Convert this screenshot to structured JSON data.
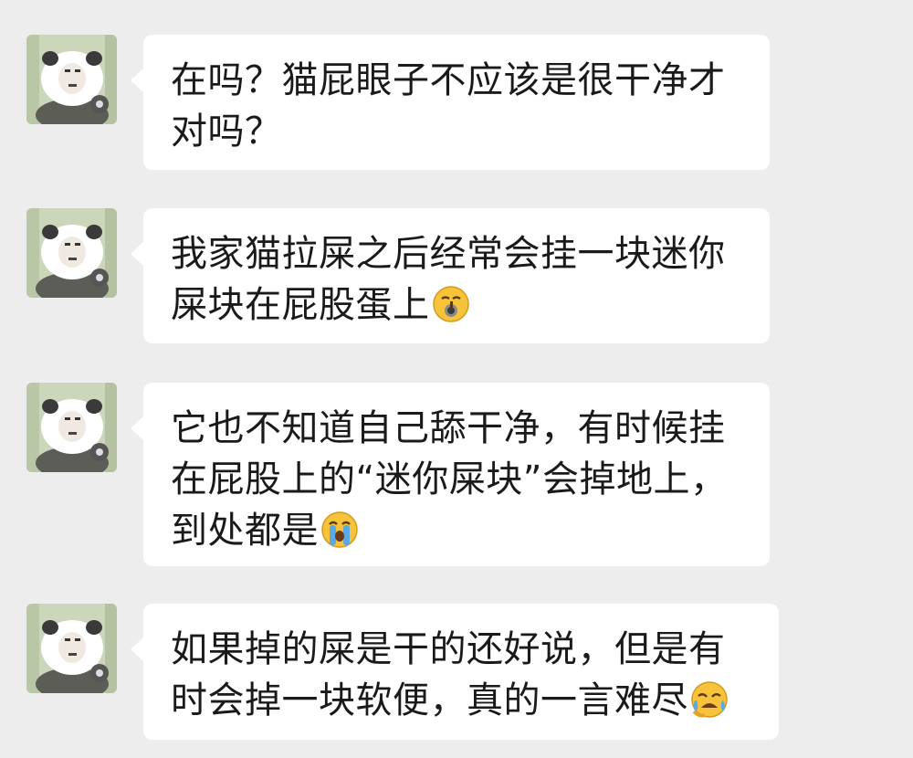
{
  "chat": {
    "messages": [
      {
        "text": "在吗？猫屁眼子不应该是很干净才对吗？",
        "emoji": ""
      },
      {
        "text": "我家猫拉屎之后经常会挂一块迷你屎块在屁股蛋上",
        "emoji": "shushing-face-emoji"
      },
      {
        "text": "它也不知道自己舔干净，有时候挂在屁股上的“迷你屎块”会掉地上，到处都是",
        "emoji": "loudly-crying-face-emoji"
      },
      {
        "text": "如果掉的屎是干的还好说，但是有时会掉一块软便，真的一言难尽",
        "emoji": "crying-face-emoji"
      }
    ],
    "avatar_icon": "panda-meme-avatar",
    "colors": {
      "background": "#ededed",
      "bubble": "#ffffff",
      "text": "#1a1a1a",
      "emoji_yellow": "#f7c33a"
    }
  }
}
